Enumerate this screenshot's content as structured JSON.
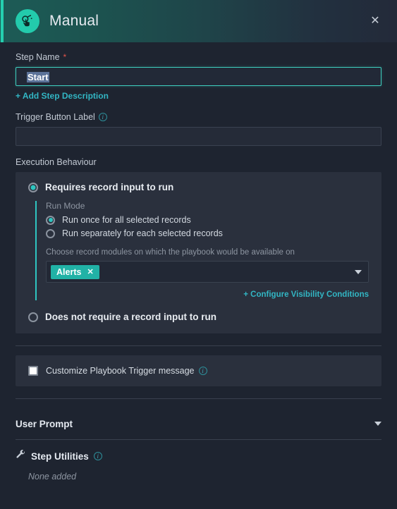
{
  "header": {
    "icon": "manual-hand-pointer-icon",
    "title": "Manual",
    "close_label": "✕",
    "accent_color": "#25d0b0"
  },
  "step_name": {
    "label": "Step Name",
    "required_mark": "*",
    "value": "Start",
    "placeholder": "",
    "add_description_link": "+ Add Step Description"
  },
  "trigger_button_label": {
    "label": "Trigger Button Label",
    "info": "i",
    "value": "",
    "placeholder": ""
  },
  "execution_behaviour": {
    "label": "Execution Behaviour",
    "options": [
      {
        "label": "Requires record input to run",
        "checked": true
      },
      {
        "label": "Does not require a record input to run",
        "checked": false
      }
    ],
    "run_mode": {
      "caption": "Run Mode",
      "options": [
        {
          "label": "Run once for all selected records",
          "checked": true
        },
        {
          "label": "Run separately for each selected records",
          "checked": false
        }
      ]
    },
    "record_modules": {
      "caption": "Choose record modules on which the playbook would be available on",
      "chips": [
        {
          "label": "Alerts",
          "remove": "✕"
        }
      ],
      "caret": "chevron-down-icon"
    },
    "visibility_link": "+ Configure Visibility Conditions"
  },
  "customize_trigger": {
    "label": "Customize Playbook Trigger message",
    "info": "i",
    "checked": false
  },
  "user_prompt": {
    "title": "User Prompt",
    "caret": "chevron-down-icon"
  },
  "step_utilities": {
    "title": "Step Utilities",
    "info": "i",
    "icon": "wrench-icon",
    "empty_text": "None added"
  }
}
